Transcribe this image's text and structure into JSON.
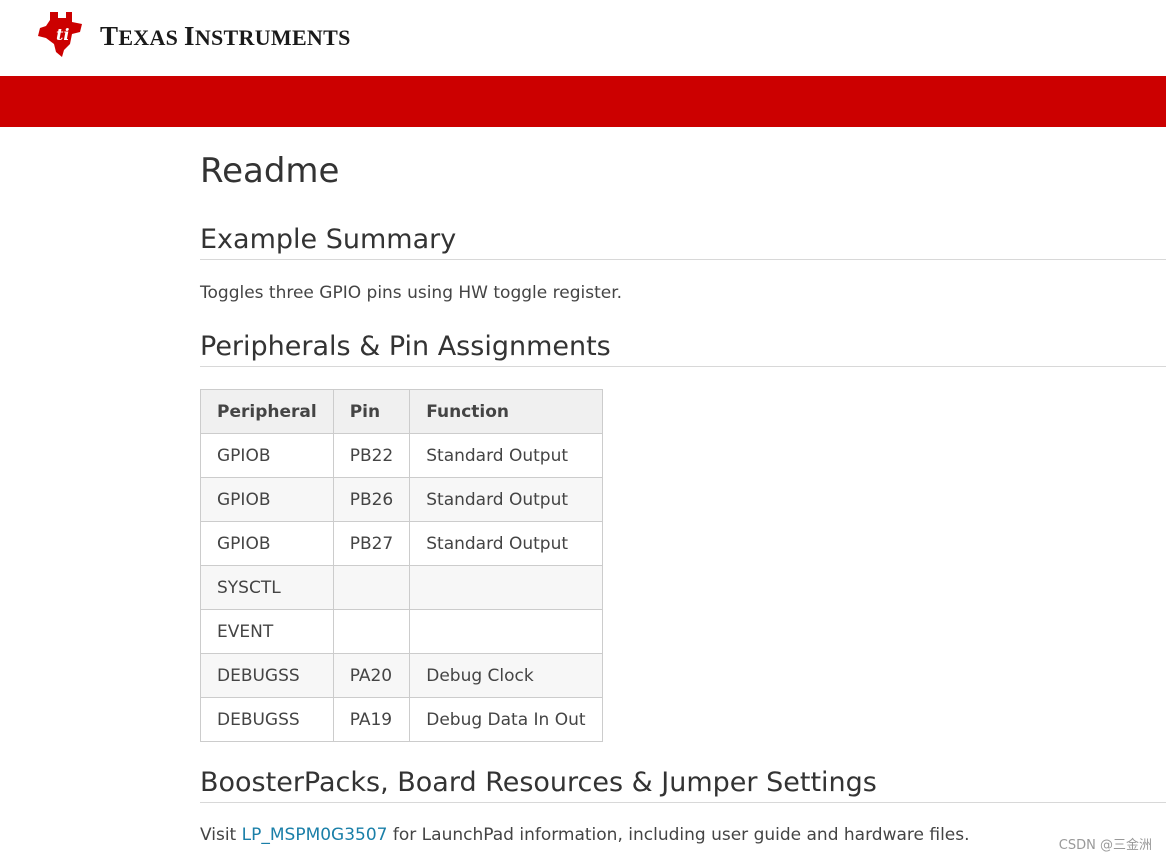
{
  "header": {
    "logo_text_big1": "T",
    "logo_text_small1": "EXAS ",
    "logo_text_big2": "I",
    "logo_text_small2": "NSTRUMENTS"
  },
  "page_title": "Readme",
  "sections": {
    "summary": {
      "heading": "Example Summary",
      "text": "Toggles three GPIO pins using HW toggle register."
    },
    "peripherals": {
      "heading": "Peripherals & Pin Assignments",
      "table": {
        "headers": [
          "Peripheral",
          "Pin",
          "Function"
        ],
        "rows": [
          [
            "GPIOB",
            "PB22",
            "Standard Output"
          ],
          [
            "GPIOB",
            "PB26",
            "Standard Output"
          ],
          [
            "GPIOB",
            "PB27",
            "Standard Output"
          ],
          [
            "SYSCTL",
            "",
            ""
          ],
          [
            "EVENT",
            "",
            ""
          ],
          [
            "DEBUGSS",
            "PA20",
            "Debug Clock"
          ],
          [
            "DEBUGSS",
            "PA19",
            "Debug Data In Out"
          ]
        ]
      }
    },
    "boosterpacks": {
      "heading": "BoosterPacks, Board Resources & Jumper Settings",
      "text_before": "Visit ",
      "link_text": "LP_MSPM0G3507",
      "text_after": " for LaunchPad information, including user guide and hardware files."
    }
  },
  "watermark": "CSDN @三金洲",
  "colors": {
    "brand_red": "#cc0000",
    "link": "#1a7fa8"
  }
}
